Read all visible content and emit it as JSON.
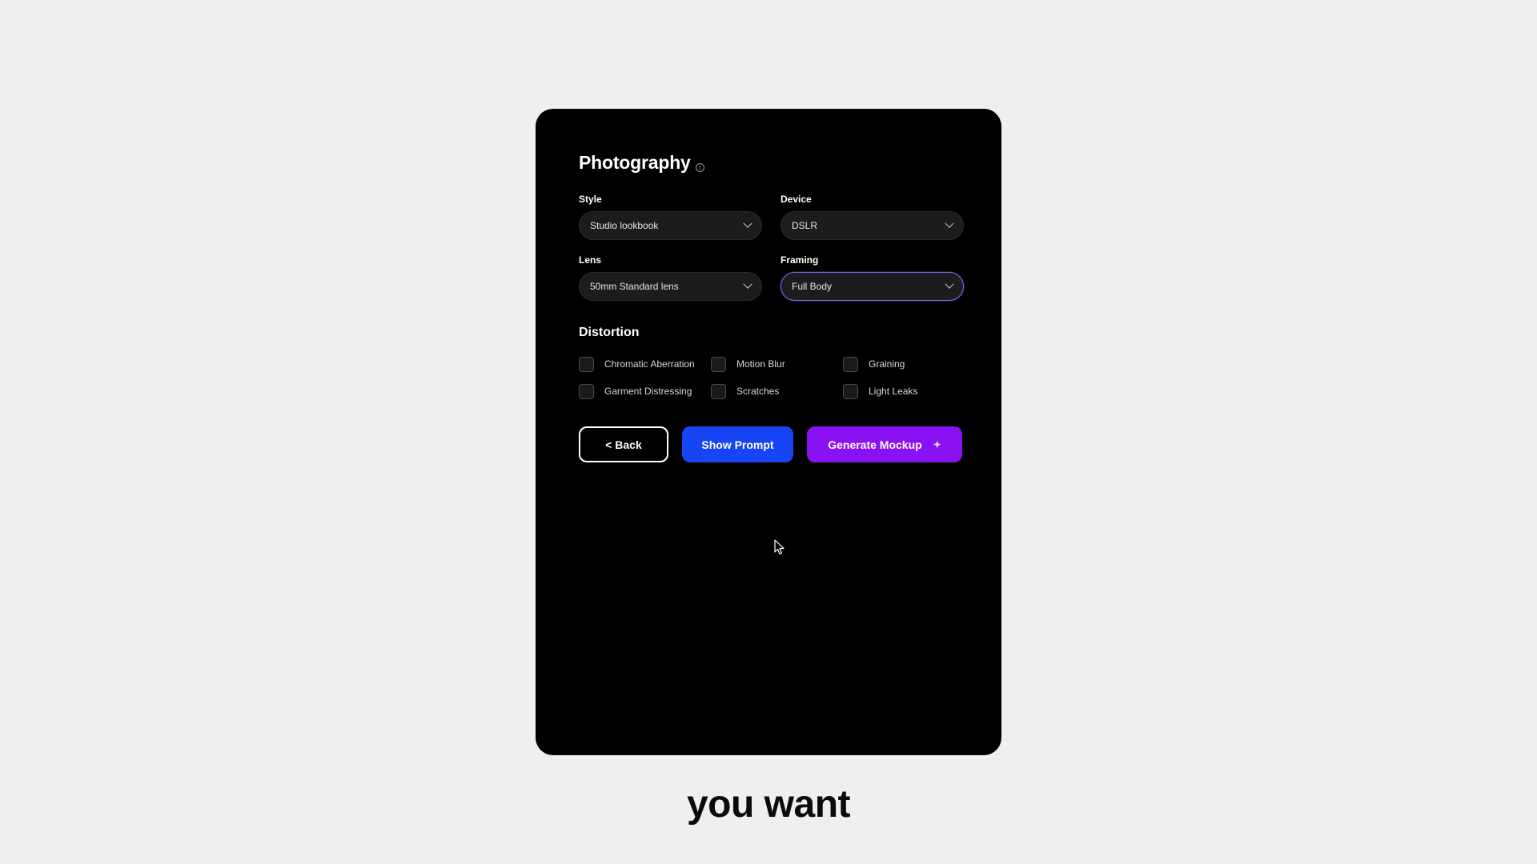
{
  "panel": {
    "title": "Photography",
    "info_icon": "info-icon"
  },
  "fields": {
    "style": {
      "label": "Style",
      "value": "Studio lookbook"
    },
    "device": {
      "label": "Device",
      "value": "DSLR"
    },
    "lens": {
      "label": "Lens",
      "value": "50mm Standard lens"
    },
    "framing": {
      "label": "Framing",
      "value": "Full Body"
    }
  },
  "distortion": {
    "title": "Distortion",
    "options": [
      {
        "label": "Chromatic Aberration",
        "checked": false
      },
      {
        "label": "Motion Blur",
        "checked": false
      },
      {
        "label": "Graining",
        "checked": false
      },
      {
        "label": "Garment Distressing",
        "checked": false
      },
      {
        "label": "Scratches",
        "checked": false
      },
      {
        "label": "Light Leaks",
        "checked": false
      }
    ]
  },
  "buttons": {
    "back": "< Back",
    "show_prompt": "Show Prompt",
    "generate": "Generate Mockup"
  },
  "caption": "you want",
  "colors": {
    "page_bg": "#efefef",
    "panel_bg": "#000000",
    "select_bg": "#1c1c1e",
    "focus_ring": "#8a5cf6",
    "prompt_button": "#1745f5",
    "generate_button": "#8a12f2"
  }
}
